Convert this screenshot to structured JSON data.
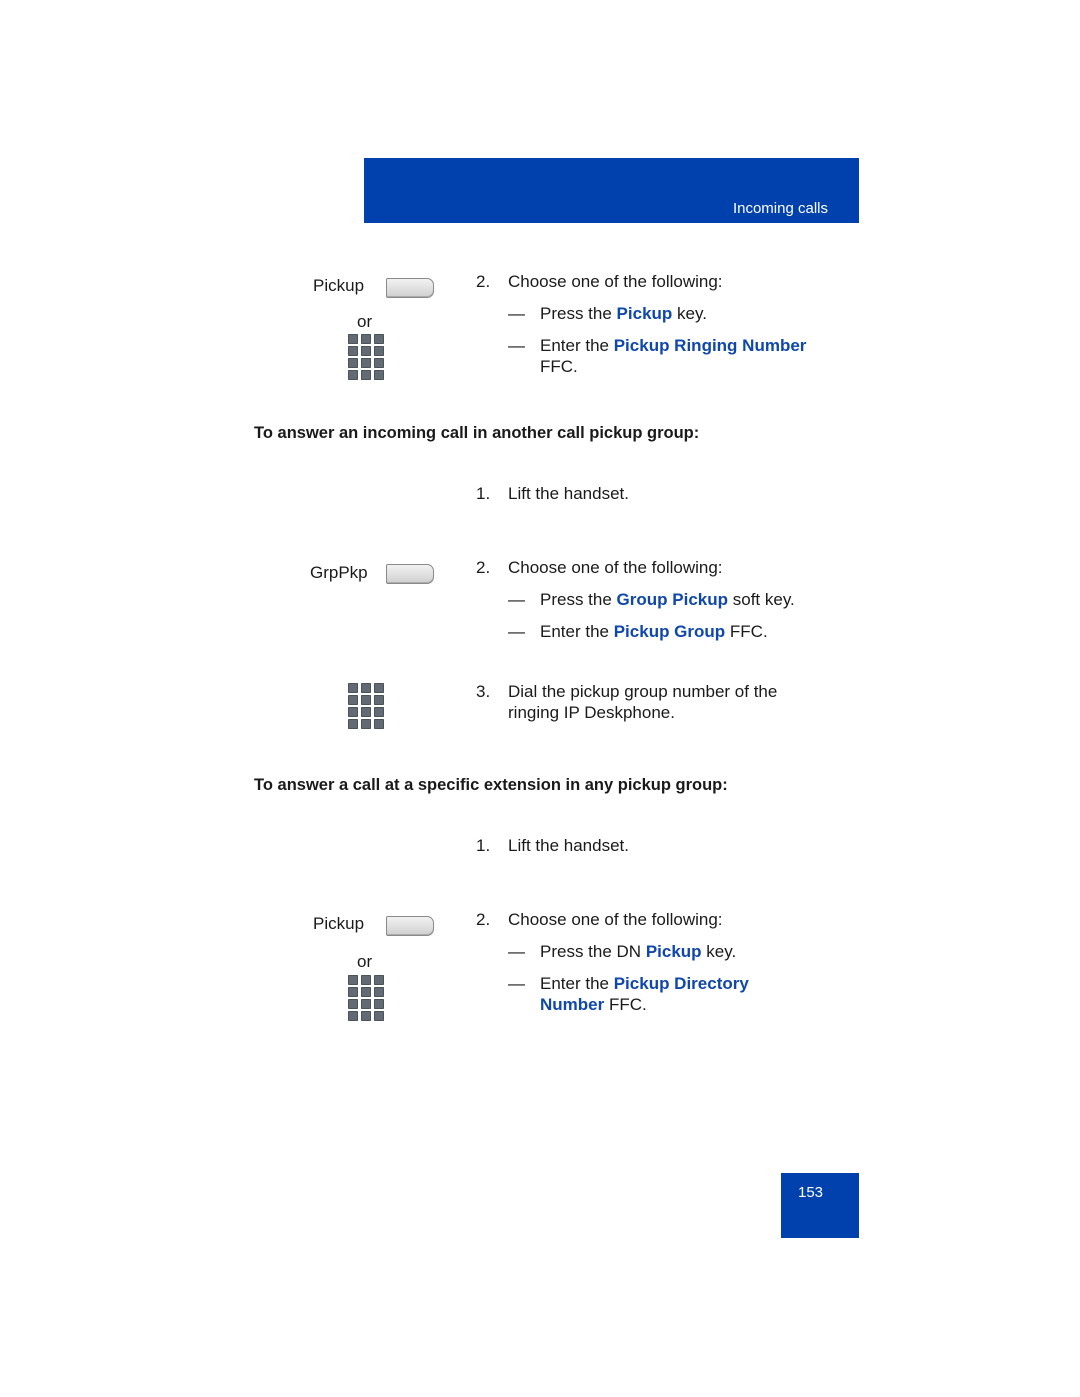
{
  "header": {
    "section_title": "Incoming calls"
  },
  "section1": {
    "softkey_label": "Pickup",
    "or_label": "or",
    "step2": {
      "num": "2.",
      "text": "Choose one of the following:",
      "options": [
        {
          "dash": "—",
          "pre": "Press the ",
          "kw": "Pickup",
          "post": " key."
        },
        {
          "dash": "—",
          "pre": "Enter the ",
          "kw": "Pickup Ringing Number",
          "line2": "FFC."
        }
      ]
    }
  },
  "section2": {
    "heading": "To answer an incoming call in another call pickup group:",
    "step1": {
      "num": "1.",
      "text": "Lift the handset."
    },
    "softkey_label": "GrpPkp",
    "step2": {
      "num": "2.",
      "text": "Choose one of the following:",
      "options": [
        {
          "dash": "—",
          "pre": "Press the ",
          "kw": "Group Pickup",
          "post": " soft key."
        },
        {
          "dash": "—",
          "pre": "Enter the ",
          "kw": "Pickup Group",
          "post": " FFC."
        }
      ]
    },
    "step3": {
      "num": "3.",
      "line1": "Dial the pickup group number of the",
      "line2": "ringing IP Deskphone."
    }
  },
  "section3": {
    "heading": "To answer a call at a specific extension in any pickup group:",
    "step1": {
      "num": "1.",
      "text": "Lift the handset."
    },
    "softkey_label": "Pickup",
    "or_label": "or",
    "step2": {
      "num": "2.",
      "text": "Choose one of the following:",
      "options": [
        {
          "dash": "—",
          "pre": "Press the DN ",
          "kw": "Pickup",
          "post": " key."
        },
        {
          "dash": "—",
          "pre": "Enter the ",
          "kw": "Pickup Directory",
          "kw2": "Number",
          "post2": " FFC."
        }
      ]
    }
  },
  "footer": {
    "page_number": "153"
  },
  "colors": {
    "brand_blue": "#0141ad",
    "keyword_blue": "#0f47ab"
  }
}
